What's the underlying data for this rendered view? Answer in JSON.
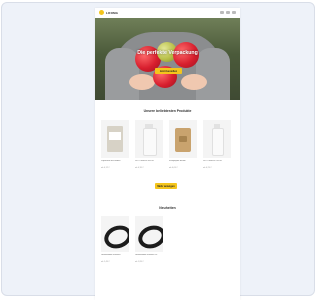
{
  "brand": {
    "name": "LOOMA"
  },
  "hero": {
    "title": "Die perfekte Verpackung",
    "cta": "Jetzt bestellen"
  },
  "sections": {
    "bestsellers_title": "Unsere beliebtesten Produkte",
    "more_button": "Mehr anzeigen",
    "novelties_title": "Neuheiten"
  },
  "products": [
    {
      "name": "Papiertüte mit Boden",
      "price": "ab 0,12 €"
    },
    {
      "name": "PET Flasche 500 ml",
      "price": "ab 0,35 €"
    },
    {
      "name": "Kraftpapier Beutel",
      "price": "ab 0,09 €"
    },
    {
      "name": "PET Flasche 250 ml",
      "price": "ab 0,29 €"
    }
  ],
  "novelties": [
    {
      "name": "Gummiband schwarz",
      "price": "ab 1,49 €"
    },
    {
      "name": "Gummiband schwarz XL",
      "price": "ab 1,89 €"
    }
  ],
  "colors": {
    "accent": "#f4c51c",
    "background": "#eef2f9"
  }
}
